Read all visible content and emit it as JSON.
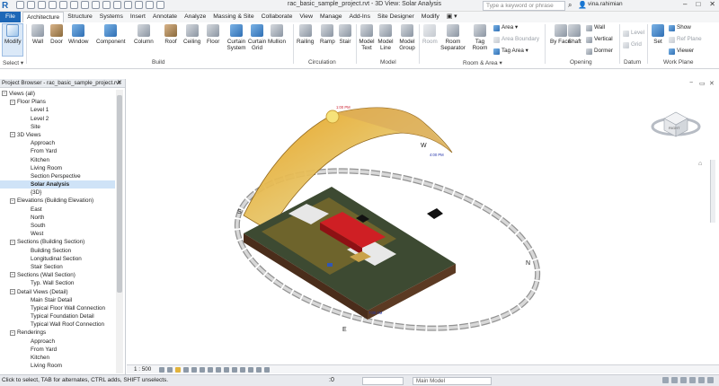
{
  "app": {
    "logo": "R",
    "title": "rac_basic_sample_project.rvt - 3D View: Solar Analysis",
    "search_placeholder": "Type a keyword or phrase",
    "user": "vina.rahimian"
  },
  "tabs": [
    "File",
    "Architecture",
    "Structure",
    "Systems",
    "Insert",
    "Annotate",
    "Analyze",
    "Massing & Site",
    "Collaborate",
    "View",
    "Manage",
    "Add-Ins",
    "Site Designer",
    "Modify",
    "▣ ▾"
  ],
  "ribbon": {
    "select": {
      "modify": "Modify",
      "select_label": "Select ▾"
    },
    "build": [
      "Wall",
      "Door",
      "Window",
      "Component",
      "Column",
      "Roof",
      "Ceiling",
      "Floor",
      "Curtain System",
      "Curtain Grid",
      "Mullion"
    ],
    "build_label": "Build",
    "circulation": [
      "Railing",
      "Ramp",
      "Stair"
    ],
    "circulation_label": "Circulation",
    "model": [
      "Model Text",
      "Model Line",
      "Model Group"
    ],
    "model_label": "Model",
    "room": [
      "Room",
      "Room Separator",
      "Tag Room"
    ],
    "room_small": [
      "Area ▾",
      "Area Boundary",
      "Tag Area ▾"
    ],
    "room_label": "Room & Area ▾",
    "opening": [
      "By Face",
      "Shaft"
    ],
    "opening_small": [
      "Wall",
      "Vertical",
      "Dormer"
    ],
    "opening_label": "Opening",
    "datum_small": [
      "Level",
      "Grid"
    ],
    "datum_label": "Datum",
    "workplane": [
      "Set"
    ],
    "workplane_small": [
      "Show",
      "Ref Plane",
      "Viewer"
    ],
    "workplane_label": "Work Plane"
  },
  "project_browser": {
    "header": "Project Browser - rac_basic_sample_project.rvt",
    "close": "✕",
    "items": [
      {
        "label": "Views (all)",
        "level": 0,
        "toggle": "−"
      },
      {
        "label": "Floor Plans",
        "level": 1,
        "toggle": "−"
      },
      {
        "label": "Level 1",
        "level": 2
      },
      {
        "label": "Level 2",
        "level": 2
      },
      {
        "label": "Site",
        "level": 2
      },
      {
        "label": "3D Views",
        "level": 1,
        "toggle": "−"
      },
      {
        "label": "Approach",
        "level": 2
      },
      {
        "label": "From Yard",
        "level": 2
      },
      {
        "label": "Kitchen",
        "level": 2
      },
      {
        "label": "Living Room",
        "level": 2
      },
      {
        "label": "Section Perspective",
        "level": 2
      },
      {
        "label": "Solar Analysis",
        "level": 2,
        "selected": true
      },
      {
        "label": "{3D}",
        "level": 2
      },
      {
        "label": "Elevations (Building Elevation)",
        "level": 1,
        "toggle": "−"
      },
      {
        "label": "East",
        "level": 2
      },
      {
        "label": "North",
        "level": 2
      },
      {
        "label": "South",
        "level": 2
      },
      {
        "label": "West",
        "level": 2
      },
      {
        "label": "Sections (Building Section)",
        "level": 1,
        "toggle": "−"
      },
      {
        "label": "Building Section",
        "level": 2
      },
      {
        "label": "Longitudinal Section",
        "level": 2
      },
      {
        "label": "Stair Section",
        "level": 2
      },
      {
        "label": "Sections (Wall Section)",
        "level": 1,
        "toggle": "−"
      },
      {
        "label": "Typ. Wall Section",
        "level": 2
      },
      {
        "label": "Detail Views (Detail)",
        "level": 1,
        "toggle": "−"
      },
      {
        "label": "Main Stair Detail",
        "level": 2
      },
      {
        "label": "Typical Floor Wall Connection",
        "level": 2
      },
      {
        "label": "Typical Foundation Detail",
        "level": 2
      },
      {
        "label": "Typical Wall Roof Connection",
        "level": 2
      },
      {
        "label": "Renderings",
        "level": 1,
        "toggle": "−"
      },
      {
        "label": "Approach",
        "level": 2
      },
      {
        "label": "From Yard",
        "level": 2
      },
      {
        "label": "Kitchen",
        "level": 2
      },
      {
        "label": "Living Room",
        "level": 2
      }
    ]
  },
  "viewport": {
    "compass": {
      "W": "W",
      "S": "S",
      "N": "N",
      "E": "E"
    },
    "sun_label": "1:00 PM",
    "sun_label2": "4:00 PM",
    "time_label": "7:00 AM",
    "viewcube_face": "RIGHT",
    "controls": [
      "−",
      "▭",
      "✕"
    ]
  },
  "view_bar": {
    "scale": "1 : 500"
  },
  "status": {
    "hint": "Click to select, TAB for alternates, CTRL adds, SHIFT unselects.",
    "workset": "",
    "model": "Main Model",
    "zero": ":0"
  }
}
